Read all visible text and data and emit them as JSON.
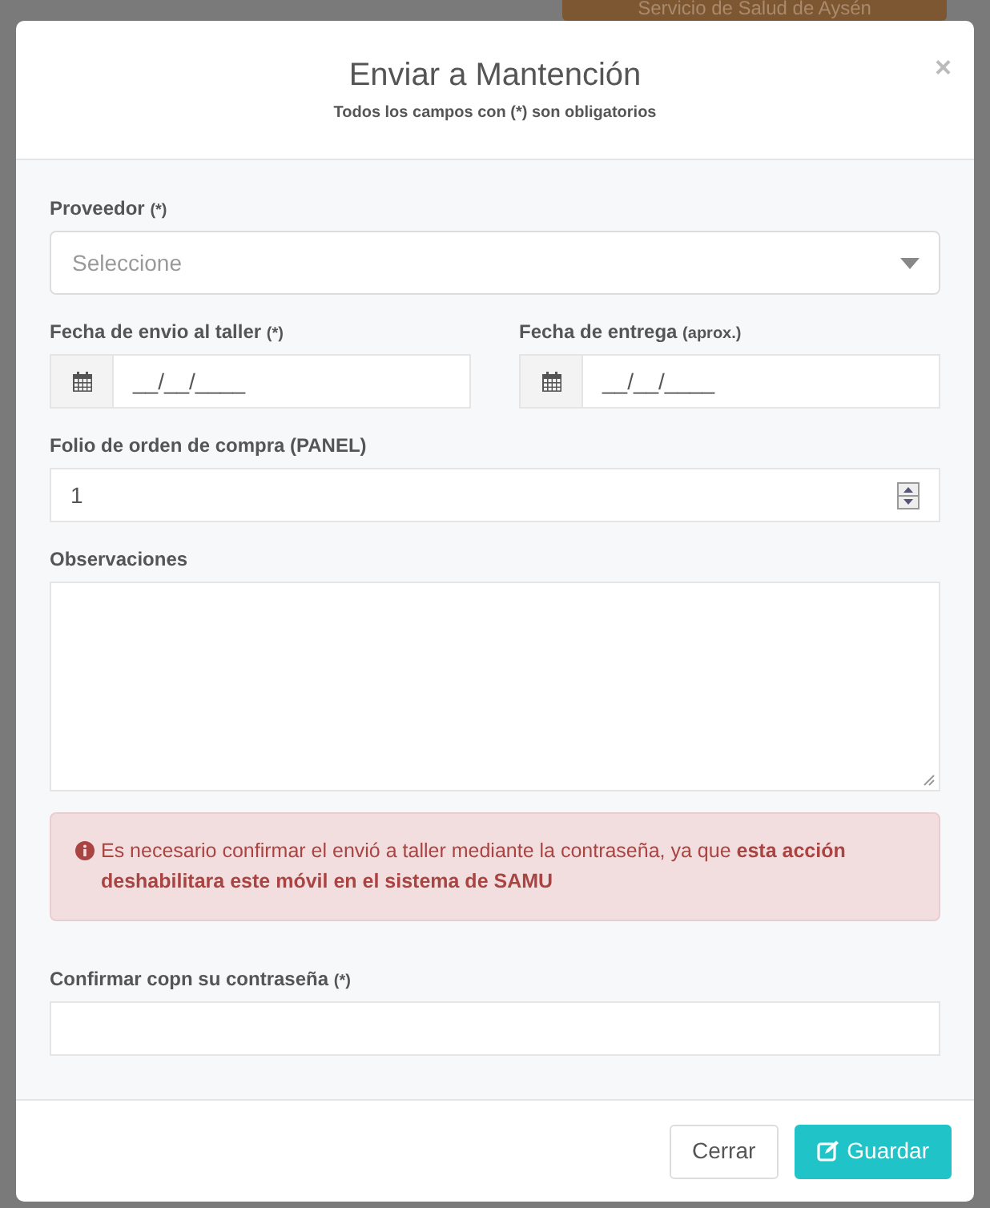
{
  "backdrop": {
    "button": "Servicio de Salud de Aysén"
  },
  "modal": {
    "title": "Enviar a Mantención",
    "subtitle": "Todos los campos con (*) son obligatorios",
    "close": "×",
    "fields": [
      {
        "kind": "select",
        "label": "Proveedor",
        "note": "(*)",
        "placeholder": "Seleccione"
      },
      {
        "kind": "date",
        "label": "Fecha de envio al taller",
        "note": "(*)",
        "value": "__/__/____"
      },
      {
        "kind": "date",
        "label": "Fecha de entrega",
        "note": "(aprox.)",
        "value": "__/__/____"
      },
      {
        "kind": "number",
        "label": "Folio de orden de compra (PANEL)",
        "value": "1"
      },
      {
        "kind": "textarea",
        "label": "Observaciones"
      },
      {
        "kind": "alert",
        "text": "Es necesario confirmar el envió a taller mediante la contraseña, ya que **esta acción deshabilitara este móvil en el sistema de SAMU**"
      },
      {
        "kind": "password",
        "label": "Confirmar copn su contraseña",
        "note": "(*)"
      }
    ],
    "buttons": [
      {
        "label": "Cerrar",
        "kind": "default"
      },
      {
        "label": "Guardar",
        "kind": "primary"
      }
    ]
  }
}
